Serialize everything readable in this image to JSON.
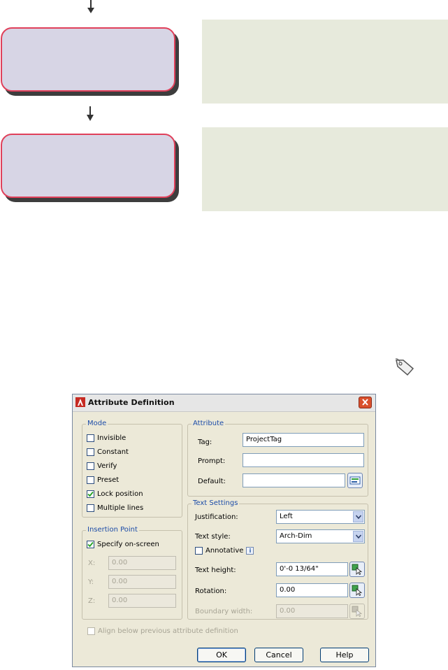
{
  "dialog": {
    "title": "Attribute Definition",
    "mode": {
      "title": "Mode",
      "items": [
        {
          "label": "Invisible",
          "checked": false
        },
        {
          "label": "Constant",
          "checked": false
        },
        {
          "label": "Verify",
          "checked": false
        },
        {
          "label": "Preset",
          "checked": false
        },
        {
          "label": "Lock position",
          "checked": true
        },
        {
          "label": "Multiple lines",
          "checked": false
        }
      ]
    },
    "attribute": {
      "title": "Attribute",
      "tag_label": "Tag:",
      "tag_value": "ProjectTag",
      "prompt_label": "Prompt:",
      "prompt_value": "",
      "default_label": "Default:",
      "default_value": ""
    },
    "insertion": {
      "title": "Insertion Point",
      "specify_label": "Specify on-screen",
      "specify_checked": true,
      "x_label": "X:",
      "x_value": "0.00",
      "y_label": "Y:",
      "y_value": "0.00",
      "z_label": "Z:",
      "z_value": "0.00"
    },
    "text_settings": {
      "title": "Text Settings",
      "justification_label": "Justification:",
      "justification_value": "Left",
      "style_label": "Text style:",
      "style_value": "Arch-Dim",
      "annotative_label": "Annotative",
      "annotative_checked": false,
      "height_label": "Text height:",
      "height_value": "0'-0 13/64\"",
      "rotation_label": "Rotation:",
      "rotation_value": "0.00",
      "boundary_label": "Boundary width:",
      "boundary_value": "0.00"
    },
    "align_label": "Align below previous attribute definition",
    "buttons": {
      "ok": "OK",
      "cancel": "Cancel",
      "help": "Help"
    }
  },
  "colors": {
    "flow_border": "#e0405a",
    "flow_fill": "#d7d5e5",
    "note_fill": "#e7eadc",
    "dialog_bg": "#ece9d8",
    "group_title": "#1c4ca8"
  },
  "icons": [
    "down-arrow-icon",
    "tag-icon",
    "autocad-icon",
    "close-icon",
    "insert-field-icon",
    "pick-point-icon",
    "info-icon",
    "check-icon",
    "chevron-down-icon"
  ]
}
